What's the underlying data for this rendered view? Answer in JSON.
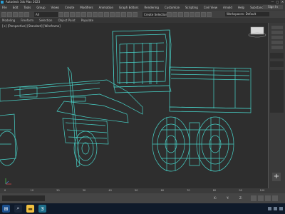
{
  "window": {
    "title": "Autodesk 3ds Max 2023",
    "controls": [
      "—",
      "□",
      "✕"
    ]
  },
  "menubar": {
    "items": [
      "File",
      "Edit",
      "Tools",
      "Group",
      "Views",
      "Create",
      "Modifiers",
      "Animation",
      "Graph Editors",
      "Rendering",
      "Customize",
      "Scripting",
      "Civil View",
      "Arnold",
      "Help",
      "Substance"
    ],
    "signin_label": "Sign In"
  },
  "toolbar": {
    "selection_filter": "All",
    "named_selection_placeholder": "Create Selection Set",
    "workspace_name": "Workspaces: Default"
  },
  "ribbon": {
    "tabs": [
      "Modeling",
      "Freeform",
      "Selection",
      "Object Paint",
      "Populate"
    ]
  },
  "viewport": {
    "label": "[+] [Perspective] [Standard] [Wireframe]",
    "wire_color": "#48d2c8",
    "background": "#2e2e2e"
  },
  "timeline": {
    "ticks": [
      "0",
      "10",
      "20",
      "30",
      "40",
      "50",
      "60",
      "70",
      "80",
      "90",
      "100"
    ]
  },
  "statusbar": {
    "x_label": "X:",
    "y_label": "Y:",
    "z_label": "Z:"
  },
  "taskbar": {
    "start_icon": "windows-start-icon",
    "apps": [
      "search-icon",
      "file-explorer-icon",
      "3ds-max-app-icon"
    ]
  }
}
